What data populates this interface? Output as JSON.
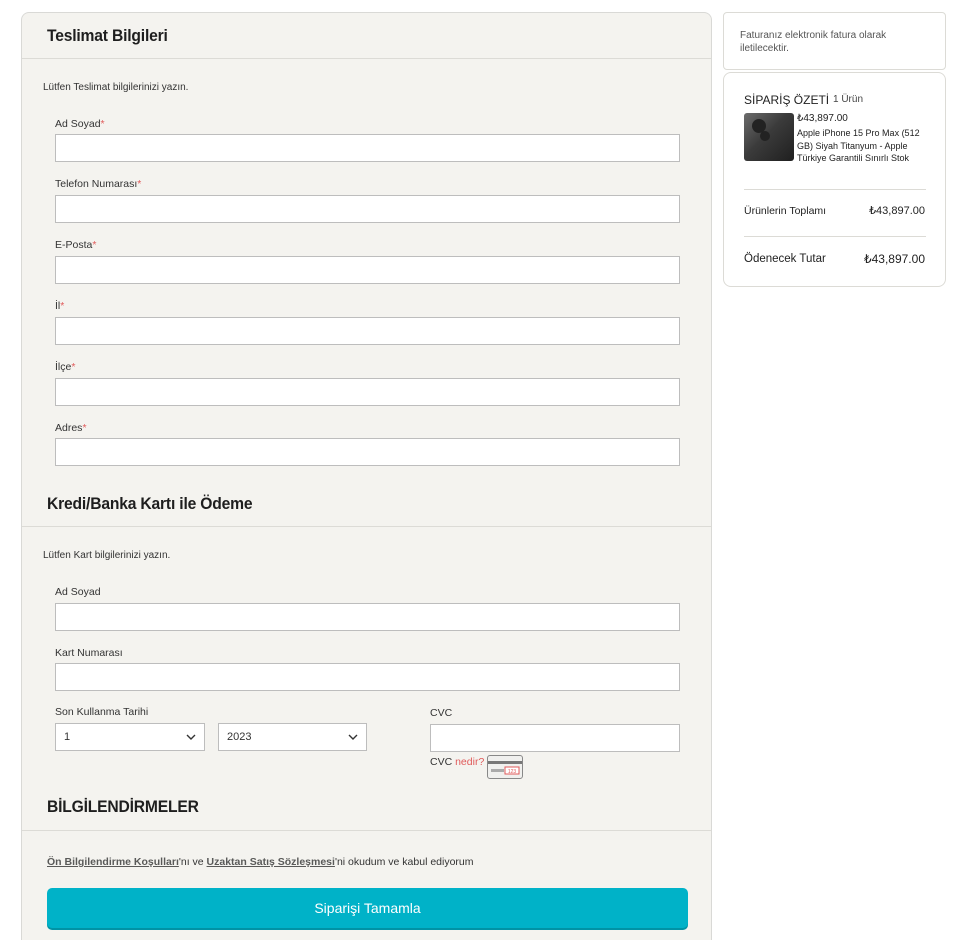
{
  "delivery": {
    "title": "Teslimat Bilgileri",
    "hint": "Lütfen Teslimat bilgilerinizi yazın.",
    "fields": [
      {
        "label": "Ad Soyad",
        "required": "*",
        "value": ""
      },
      {
        "label": "Telefon Numarası",
        "required": "*",
        "value": ""
      },
      {
        "label": "E-Posta",
        "required": "*",
        "value": ""
      },
      {
        "label": "İl",
        "required": "*",
        "value": ""
      },
      {
        "label": "İlçe",
        "required": "*",
        "value": ""
      },
      {
        "label": "Adres",
        "required": "*",
        "value": ""
      }
    ]
  },
  "payment": {
    "title": "Kredi/Banka Kartı ile Ödeme",
    "hint": "Lütfen Kart bilgilerinizi yazın.",
    "name_label": "Ad Soyad",
    "card_number_label": "Kart Numarası",
    "expiry_label": "Son Kullanma Tarihi",
    "month_value": "1",
    "year_value": "2023",
    "cvc_label": "CVC",
    "cvc_help_prefix": "CVC",
    "cvc_help_link": "nedir?",
    "card_icon_text": "123"
  },
  "notifications": {
    "title": "BİLGİLENDİRMELER",
    "link1": "Ön Bilgilendirme Koşulları",
    "mid_text": "'nı ve ",
    "link2": "Uzaktan Satış Sözleşmesi",
    "end_text": "'ni okudum ve kabul ediyorum"
  },
  "submit_label": "Siparişi Tamamla",
  "invoice_note": "Faturanız elektronik fatura olarak iletilecektir.",
  "summary": {
    "title": "SİPARİŞ ÖZETİ",
    "count": "1 Ürün",
    "product_price": "₺43,897.00",
    "product_name": "Apple iPhone 15 Pro Max (512 GB) Siyah Titanyum - Apple Türkiye Garantili Sınırlı Stok",
    "subtotal_label": "Ürünlerin Toplamı",
    "subtotal_value": "₺43,897.00",
    "total_label": "Ödenecek Tutar",
    "total_value": "₺43,897.00"
  },
  "colors": {
    "accent": "#00b2c8",
    "required": "#e05a5a",
    "panel_bg": "#f4f3ef"
  }
}
